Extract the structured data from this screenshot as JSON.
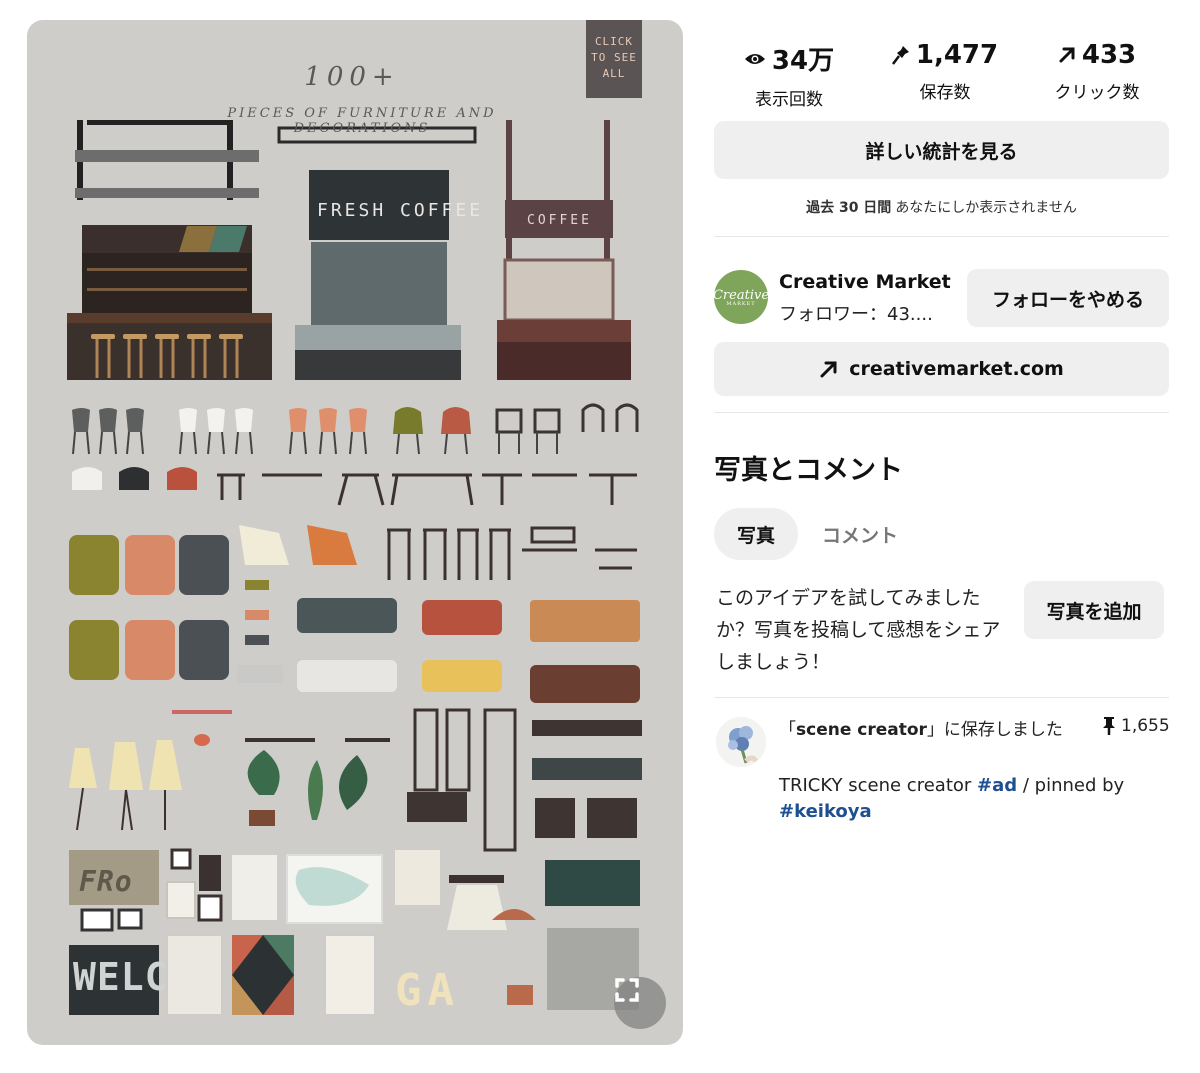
{
  "pin_image": {
    "poster_title": "100+",
    "poster_subtitle": "PIECES OF FURNITURE AND DECORATIONS",
    "click_badge": [
      "CLICK",
      "TO SEE",
      "ALL"
    ],
    "sign_fresh_coffee": "FRESH COFFEE",
    "sign_coffee": "COFFEE",
    "letters_gallery": "GA",
    "word_welcome": "WELC",
    "word_fr": "FRo"
  },
  "stats": {
    "views": {
      "value": "34万",
      "label": "表示回数",
      "icon": "eye-icon"
    },
    "saves": {
      "value": "1,477",
      "label": "保存数",
      "icon": "pin-icon"
    },
    "clicks": {
      "value": "433",
      "label": "クリック数",
      "icon": "arrow-up-right-icon"
    }
  },
  "details_button": "詳しい統計を見る",
  "privacy_note": {
    "bold": "過去 30 日間",
    "rest": "あなたにしか表示されません"
  },
  "creator": {
    "name": "Creative Market",
    "followers": "フォロワー：43....",
    "avatar_text": "Creative",
    "avatar_sub": "MARKET",
    "unfollow_button": "フォローをやめる"
  },
  "link_button": "creativemarket.com",
  "photos_section": {
    "title": "写真とコメント",
    "tabs": [
      "写真",
      "コメント"
    ],
    "prompt": "このアイデアを試してみましたか？写真を投稿して感想をシェアしましょう！",
    "add_photo_button": "写真を追加"
  },
  "saved_to": {
    "pre": "「",
    "board": "scene creator",
    "post": "」に保存しました",
    "count": "1,655",
    "desc_pre": "TRICKY scene creator ",
    "hashtag1": "#ad",
    "desc_mid": " / pinned by ",
    "hashtag2": "#keikoya"
  },
  "colors": {
    "button_grey": "#efefef",
    "hashtag_blue": "#1d4f91",
    "image_bg": "#cfcdca",
    "creator_green": "#7fa55b"
  }
}
